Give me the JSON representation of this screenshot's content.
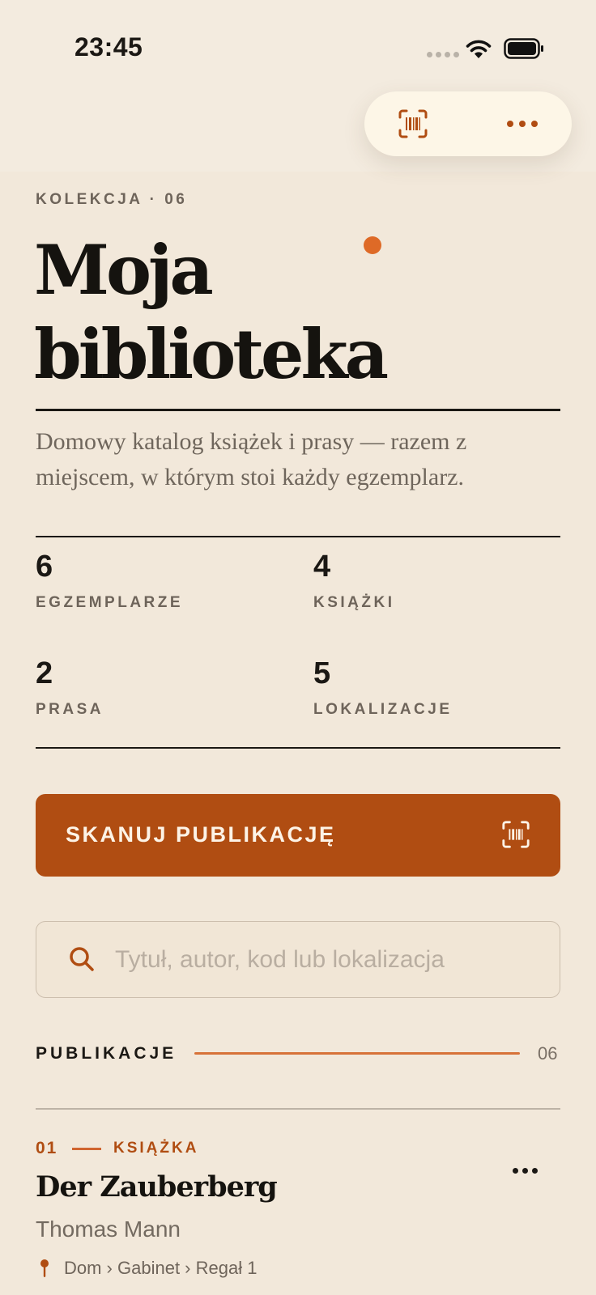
{
  "status_bar": {
    "time": "23:45"
  },
  "header": {
    "kicker": "KOLEKCJA · 06",
    "title": "Moja biblioteka",
    "subtitle": "Domowy katalog książek i prasy — razem z miejscem, w którym stoi każdy egzemplarz."
  },
  "stats": [
    {
      "value": "6",
      "label": "EGZEMPLARZE"
    },
    {
      "value": "4",
      "label": "KSIĄŻKI"
    },
    {
      "value": "2",
      "label": "PRASA"
    },
    {
      "value": "5",
      "label": "LOKALIZACJE"
    }
  ],
  "scan_button": {
    "label": "SKANUJ PUBLIKACJĘ"
  },
  "search": {
    "placeholder": "Tytuł, autor, kod lub lokalizacja",
    "value": ""
  },
  "section": {
    "label": "PUBLIKACJE",
    "count": "06"
  },
  "items": [
    {
      "number": "01",
      "type": "KSIĄŻKA",
      "title": "Der Zauberberg",
      "author": "Thomas Mann",
      "location": "Dom › Gabinet › Regał 1"
    }
  ],
  "colors": {
    "accent": "#b04d12",
    "accent_light": "#de6a27",
    "background": "#f2e8da",
    "text": "#1b1814"
  },
  "icons": {
    "barcode": "barcode-scan-icon",
    "more": "more-horizontal-icon",
    "search": "search-icon",
    "location": "location-pin-icon"
  }
}
